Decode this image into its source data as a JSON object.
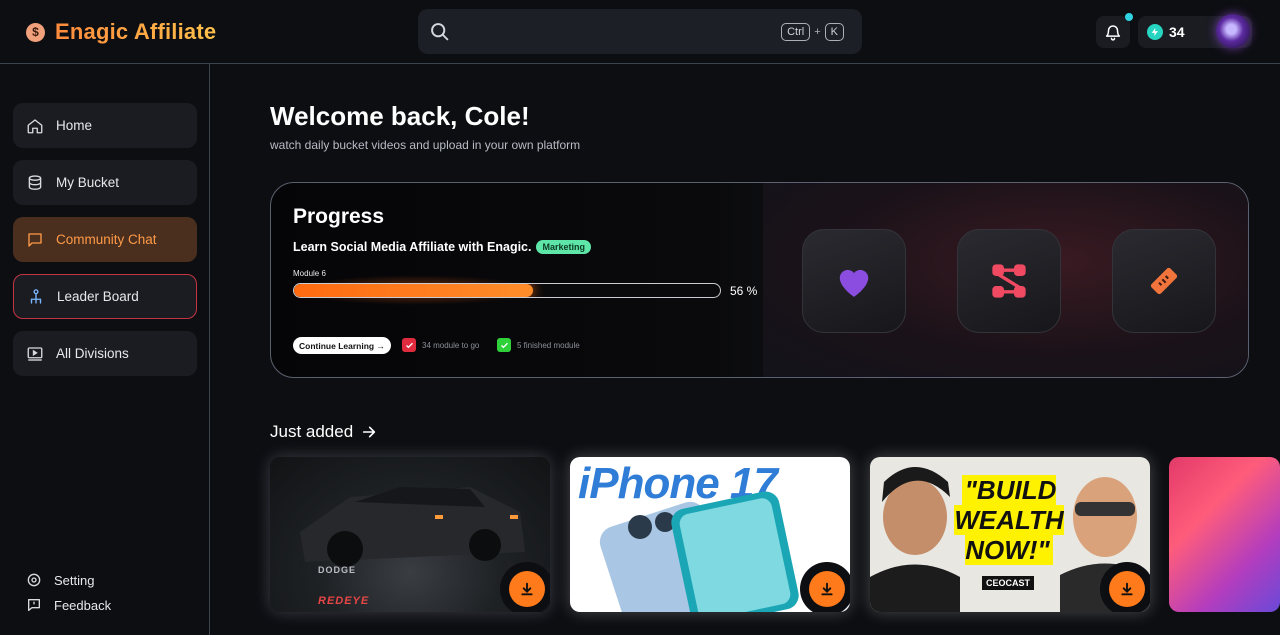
{
  "brand": {
    "name": "Enagic Affiliate",
    "icon": "dollar-icon"
  },
  "search": {
    "placeholder": "",
    "shortcut_ctrl": "Ctrl",
    "shortcut_plus": "+",
    "shortcut_key": "K"
  },
  "header": {
    "points": "34"
  },
  "sidebar": {
    "items": [
      {
        "label": "Home",
        "icon": "home-icon"
      },
      {
        "label": "My Bucket",
        "icon": "database-icon"
      },
      {
        "label": "Community Chat",
        "icon": "chat-icon"
      },
      {
        "label": "Leader Board",
        "icon": "leaderboard-icon"
      },
      {
        "label": "All Divisions",
        "icon": "video-icon"
      }
    ],
    "bottom": [
      {
        "label": "Setting",
        "icon": "settings-icon"
      },
      {
        "label": "Feedback",
        "icon": "feedback-icon"
      }
    ]
  },
  "main": {
    "welcome": "Welcome back, Cole!",
    "subtitle": "watch daily bucket videos and upload in your own platform"
  },
  "progress": {
    "title": "Progress",
    "course": "Learn Social Media Affiliate with Enagic.",
    "tag": "Marketing",
    "module_label": "Module 6",
    "percent": 56,
    "percent_label": "56 %",
    "continue_label": "Continue Learning →",
    "to_go_label": "34 module to go",
    "finished_label": "5 finished module",
    "colors": {
      "bar": "#ff6a10",
      "to_go": "#e02a3e",
      "finished": "#2ed13a",
      "tag": "#5ee6a8"
    }
  },
  "just_added": {
    "title": "Just added",
    "videos": [
      {
        "text_top": "DODGE",
        "text_bottom": "REDEYE"
      },
      {
        "text_top": "iPhone 17"
      },
      {
        "text_top": "\"BUILD WEALTH NOW!\"",
        "text_bottom": "CEOCAST"
      },
      {}
    ]
  }
}
